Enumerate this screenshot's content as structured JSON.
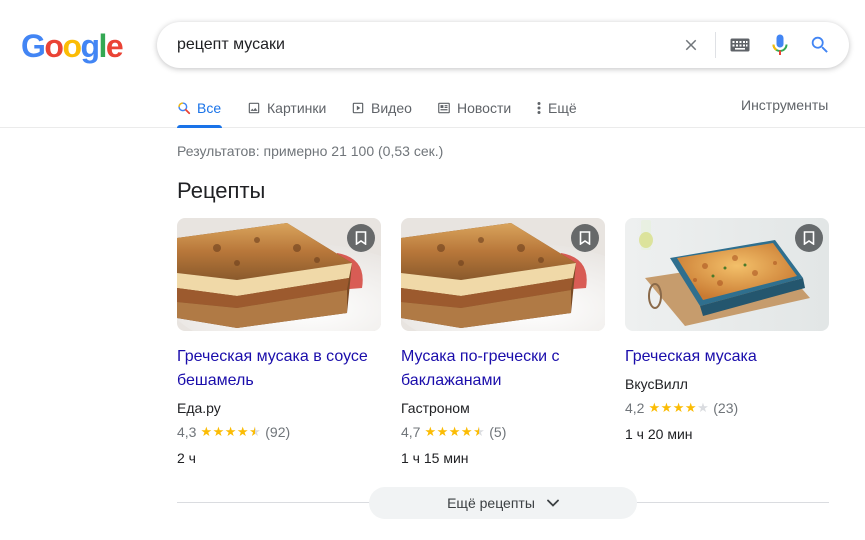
{
  "logo": {
    "letters": [
      "G",
      "o",
      "o",
      "g",
      "l",
      "e"
    ],
    "colors": [
      "#4285f4",
      "#ea4335",
      "#fbbc05",
      "#4285f4",
      "#34a853",
      "#ea4335"
    ]
  },
  "search": {
    "query": "рецепт мусаки"
  },
  "tabs": [
    {
      "label": "Все",
      "icon": "search-icon",
      "active": true
    },
    {
      "label": "Картинки",
      "icon": "image-icon"
    },
    {
      "label": "Видео",
      "icon": "video-icon"
    },
    {
      "label": "Новости",
      "icon": "news-icon"
    },
    {
      "label": "Ещё",
      "icon": "more-vert-icon"
    }
  ],
  "tools_label": "Инструменты",
  "stats": "Результатов: примерно 21 100 (0,53 сек.)",
  "recipes": {
    "title": "Рецепты",
    "cards": [
      {
        "title": "Греческая мусака в соусе бешамель",
        "source": "Еда.ру",
        "rating": "4,3",
        "reviews": "(92)",
        "stars": 4.5,
        "time": "2 ч"
      },
      {
        "title": "Мусака по-гречески с баклажанами",
        "source": "Гастроном",
        "rating": "4,7",
        "reviews": "(5)",
        "stars": 4.5,
        "time": "1 ч 15 мин"
      },
      {
        "title": "Греческая мусака",
        "source": "ВкусВилл",
        "rating": "4,2",
        "reviews": "(23)",
        "stars": 4,
        "time": "1 ч 20 мин"
      }
    ],
    "more_label": "Ещё рецепты"
  },
  "accent_color": "#1a73e8",
  "link_color": "#1a0dab",
  "star_color": "#fbbc04"
}
